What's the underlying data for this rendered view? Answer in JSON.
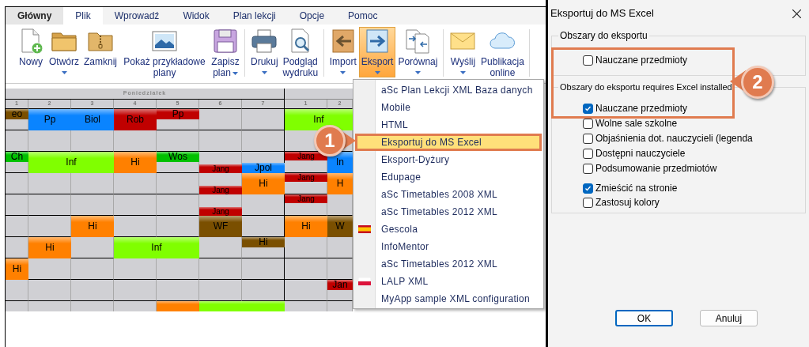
{
  "tabs": [
    {
      "label": "Główny",
      "kind": "app",
      "selected": false
    },
    {
      "label": "Plik",
      "kind": "tab",
      "selected": true
    },
    {
      "label": "Wprowadź",
      "kind": "tab",
      "selected": false
    },
    {
      "label": "Widok",
      "kind": "tab",
      "selected": false
    },
    {
      "label": "Plan lekcji",
      "kind": "tab",
      "selected": false
    },
    {
      "label": "Opcje",
      "kind": "tab",
      "selected": false
    },
    {
      "label": "Pomoc",
      "kind": "tab",
      "selected": false
    }
  ],
  "ribbon": {
    "groups": [
      {
        "buttons": [
          {
            "label": "Nowy",
            "kind": "large",
            "dropdown": false,
            "pressed": false
          },
          {
            "label": "Otwórz",
            "kind": "large",
            "dropdown": true,
            "pressed": false
          },
          {
            "label": "Zamknij",
            "kind": "large",
            "dropdown": false,
            "pressed": false
          },
          {
            "label": "Pokaż przykładowe plany",
            "kind": "large",
            "dropdown": false,
            "pressed": false
          },
          {
            "label": "Zapisz plan",
            "kind": "inline_caret",
            "dropdown": true,
            "pressed": false
          }
        ]
      },
      {
        "buttons": [
          {
            "label": "Drukuj",
            "kind": "large",
            "dropdown": true,
            "pressed": false
          },
          {
            "label": "Podgląd wydruku",
            "kind": "large",
            "dropdown": false,
            "pressed": false
          }
        ]
      },
      {
        "buttons": [
          {
            "label": "Import",
            "kind": "large",
            "dropdown": true,
            "pressed": false
          },
          {
            "label": "Eksport",
            "kind": "large",
            "dropdown": true,
            "pressed": true
          },
          {
            "label": "Porównaj",
            "kind": "large",
            "dropdown": true,
            "pressed": false
          }
        ]
      },
      {
        "buttons": [
          {
            "label": "Wyślij",
            "kind": "large",
            "dropdown": true,
            "pressed": false
          },
          {
            "label": "Publikacja online",
            "kind": "large",
            "dropdown": false,
            "pressed": false
          }
        ]
      }
    ]
  },
  "timetable": {
    "day_header": "Poniedziałek",
    "periods": [
      "1",
      "2",
      "3",
      "4",
      "5",
      "6",
      "7",
      "1",
      "2"
    ],
    "rows": [
      [
        {
          "text": "eo",
          "color": "#7a4f00",
          "kind": "top",
          "wide": false
        },
        {
          "text": "Pp",
          "color": "#0a84ff",
          "kind": "full",
          "wide": false
        },
        {
          "text": "Biol",
          "color": "#0a84ff",
          "kind": "full",
          "wide": false
        },
        {
          "text": "Rob",
          "color": "#c00000",
          "kind": "full",
          "wide": false
        },
        {
          "text": "Pp",
          "color": "#c00000",
          "kind": "top",
          "wide": false
        },
        null,
        null,
        {
          "text": "Inf",
          "color": "#80ff00",
          "kind": "full",
          "wide": true
        },
        null
      ],
      [
        null,
        null,
        null,
        null,
        null,
        null,
        null,
        null,
        null
      ],
      [
        {
          "text": "Ch",
          "color": "#00c000",
          "kind": "top",
          "wide": false
        },
        {
          "text": "Inf",
          "color": "#80ff00",
          "kind": "full",
          "wide": true
        },
        null,
        {
          "text": "Hi",
          "color": "#ff8000",
          "kind": "full",
          "wide": false
        },
        {
          "text": "Wos",
          "color": "#00c000",
          "kind": "top",
          "wide": false
        },
        {
          "text": "Jang",
          "color": "#c00000",
          "kind": "strip_bottom",
          "wide": false
        },
        {
          "text": "Jpol",
          "color": "#0a84ff",
          "kind": "bottom",
          "wide": false
        },
        {
          "text": "Jang",
          "color": "#c00000",
          "kind": "strip_top",
          "wide": false
        },
        {
          "text": "In",
          "color": "#0a84ff",
          "kind": "full",
          "wide": false
        }
      ],
      [
        null,
        null,
        null,
        null,
        null,
        {
          "text": "Jang",
          "color": "#c00000",
          "kind": "strip_bottom",
          "wide": false
        },
        {
          "text": "Hi",
          "color": "#ff8000",
          "kind": "full",
          "wide": false
        },
        {
          "text": "Jang",
          "color": "#c00000",
          "kind": "strip_top",
          "wide": false
        },
        {
          "text": "H",
          "color": "#ff8000",
          "kind": "full",
          "wide": false
        }
      ],
      [
        null,
        null,
        null,
        null,
        null,
        {
          "text": "Jang",
          "color": "#c00000",
          "kind": "strip_bottom",
          "wide": false
        },
        null,
        {
          "text": "Jang",
          "color": "#c00000",
          "kind": "strip_top",
          "wide": false
        },
        null
      ],
      [
        null,
        null,
        {
          "text": "Hi",
          "color": "#ff8000",
          "kind": "full",
          "wide": false
        },
        null,
        null,
        {
          "text": "WF",
          "color": "#7a4f00",
          "kind": "full",
          "wide": false
        },
        null,
        {
          "text": "Hi",
          "color": "#ff8000",
          "kind": "full",
          "wide": false
        },
        {
          "text": "W",
          "color": "#7a4f00",
          "kind": "full",
          "wide": false
        }
      ],
      [
        null,
        {
          "text": "Hi",
          "color": "#ff8000",
          "kind": "full",
          "wide": false
        },
        null,
        {
          "text": "Inf",
          "color": "#80ff00",
          "kind": "full",
          "wide": true
        },
        null,
        null,
        {
          "text": "Hi",
          "color": "#7a4f00",
          "kind": "top",
          "wide": false
        },
        null,
        null
      ],
      [
        {
          "text": "Hi",
          "color": "#ff8000",
          "kind": "full",
          "wide": false
        },
        null,
        null,
        null,
        null,
        null,
        null,
        null,
        null
      ],
      [
        null,
        null,
        null,
        null,
        null,
        null,
        null,
        null,
        {
          "text": "Jan",
          "color": "#c00000",
          "kind": "top",
          "wide": false
        }
      ],
      [
        null,
        null,
        null,
        null,
        {
          "color": "#ff8000",
          "kind": "full",
          "wide": false
        },
        {
          "color": "#80ff00",
          "kind": "full",
          "wide": true
        },
        null,
        null,
        null
      ]
    ]
  },
  "menu": {
    "items": [
      {
        "label": "aSc Plan Lekcji XML Baza danych",
        "kind": "plain",
        "selected": false
      },
      {
        "label": "Mobile",
        "kind": "plain",
        "selected": false
      },
      {
        "label": "HTML",
        "kind": "plain",
        "selected": false
      },
      {
        "label": "Eksportuj do MS Excel",
        "kind": "plain",
        "selected": true
      },
      {
        "label": "Eksport-Dyżury",
        "kind": "plain",
        "selected": false
      },
      {
        "label": "Edupage",
        "kind": "plain",
        "selected": false
      },
      {
        "label": "aSc Timetables 2008 XML",
        "kind": "plain",
        "selected": false
      },
      {
        "label": "aSc Timetables 2012 XML",
        "kind": "plain",
        "selected": false
      },
      {
        "label": "Gescola",
        "kind": "flag_es",
        "selected": false
      },
      {
        "label": "InfoMentor",
        "kind": "plain",
        "selected": false
      },
      {
        "label": "aSc Timetables 2012 XML",
        "kind": "plain",
        "selected": false
      },
      {
        "label": "LALP XML",
        "kind": "flag_pl",
        "selected": false
      },
      {
        "label": "MyApp sample XML configuration",
        "kind": "plain",
        "selected": false
      }
    ]
  },
  "dialog": {
    "title": "Eksportuj do MS Excel",
    "group_1": {
      "legend": "Obszary do eksportu",
      "options": [
        {
          "label": "Nauczane przedmioty",
          "checked": false
        }
      ]
    },
    "group_2": {
      "legend": "Obszary do eksportu requires Excel installed",
      "options": [
        {
          "label": "Nauczane przedmioty",
          "checked": true
        },
        {
          "label": "Wolne sale szkolne",
          "checked": false
        },
        {
          "label": "Objaśnienia dot. nauczycieli (legenda",
          "checked": false
        },
        {
          "label": "Dostępni nauczyciele",
          "checked": false
        },
        {
          "label": "Podsumowanie przedmiotów",
          "checked": false
        }
      ],
      "layout_options": [
        {
          "label": "Zmieścić na stronie",
          "checked": true
        },
        {
          "label": "Zastosuj kolory",
          "checked": false
        }
      ]
    },
    "buttons": [
      {
        "label": "OK",
        "default": true
      },
      {
        "label": "Anuluj",
        "default": false
      }
    ]
  },
  "annotations": [
    {
      "label": "1"
    },
    {
      "label": "2"
    }
  ]
}
